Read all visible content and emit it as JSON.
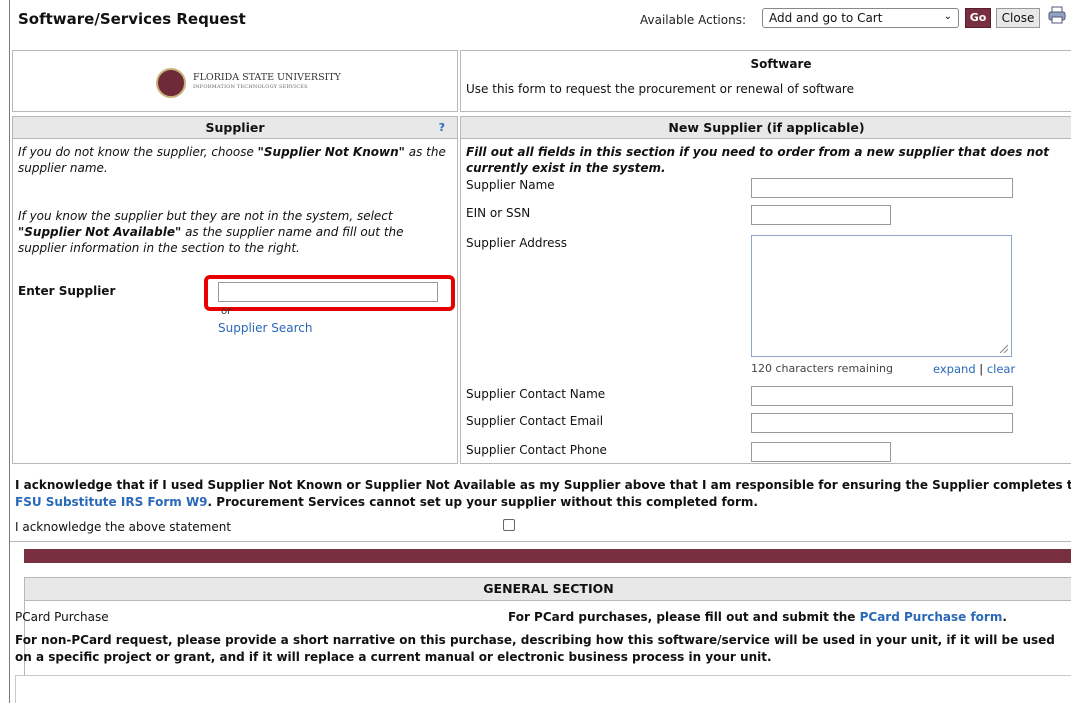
{
  "header": {
    "title": "Software/Services Request",
    "actions_label": "Available Actions:",
    "actions_selected": "Add and go to Cart",
    "go_label": "Go",
    "close_label": "Close"
  },
  "logo": {
    "line1": "FLORIDA STATE UNIVERSITY",
    "line2": "INFORMATION TECHNOLOGY SERVICES"
  },
  "form_intro": {
    "heading": "Software",
    "text": "Use this form to request the procurement or renewal of software"
  },
  "supplier": {
    "heading": "Supplier",
    "help": "?",
    "p1_a": "If you do not know the supplier, choose ",
    "p1_b": "\"Supplier Not Known\"",
    "p1_c": " as the supplier name.",
    "p2_a": "If you know the supplier but they are not in the system, select ",
    "p2_b": "\"Supplier Not Available\"",
    "p2_c": " as the supplier name and fill out the supplier information in the section to the right.",
    "enter_label": "Enter Supplier",
    "input_value": "",
    "or_text": "or",
    "search_link": "Supplier Search"
  },
  "new_supplier": {
    "heading": "New Supplier (if applicable)",
    "intro": "Fill out all fields in this section if you need to order from a new supplier that does not currently exist in the system.",
    "name_label": "Supplier Name",
    "ein_label": "EIN or SSN",
    "address_label": "Supplier Address",
    "remaining": "120 characters remaining",
    "expand": "expand",
    "sep": "|",
    "clear": "clear",
    "contact_name_label": "Supplier Contact Name",
    "contact_email_label": "Supplier Contact Email",
    "contact_phone_label": "Supplier Contact Phone"
  },
  "acknowledge": {
    "text_a": "I acknowledge that if I used Supplier Not Known or Supplier Not Available as my Supplier above that I am responsible for ensuring the Supplier completes the ",
    "link": "FSU Substitute IRS Form W9",
    "text_b": ". Procurement Services cannot set up your supplier without this completed form.",
    "checkbox_label": "I acknowledge the above statement"
  },
  "general": {
    "heading": "GENERAL SECTION",
    "pcard_label": "PCard Purchase",
    "pcard_text": "For PCard purchases, please fill out and submit the ",
    "pcard_link": "PCard Purchase form",
    "pcard_end": ".",
    "narrative": "For non-PCard request, please provide a short narrative on this purchase, describing how this software/service will be used in your unit, if it will be used on a specific project or grant, and if it will replace a current manual or electronic business process in your unit."
  },
  "colors": {
    "garnet": "#782f40",
    "link": "#2a68b8",
    "highlight": "#e60000"
  },
  "icons": [
    "print-icon",
    "chevron-down-icon",
    "help-icon",
    "resize-grip-icon"
  ]
}
